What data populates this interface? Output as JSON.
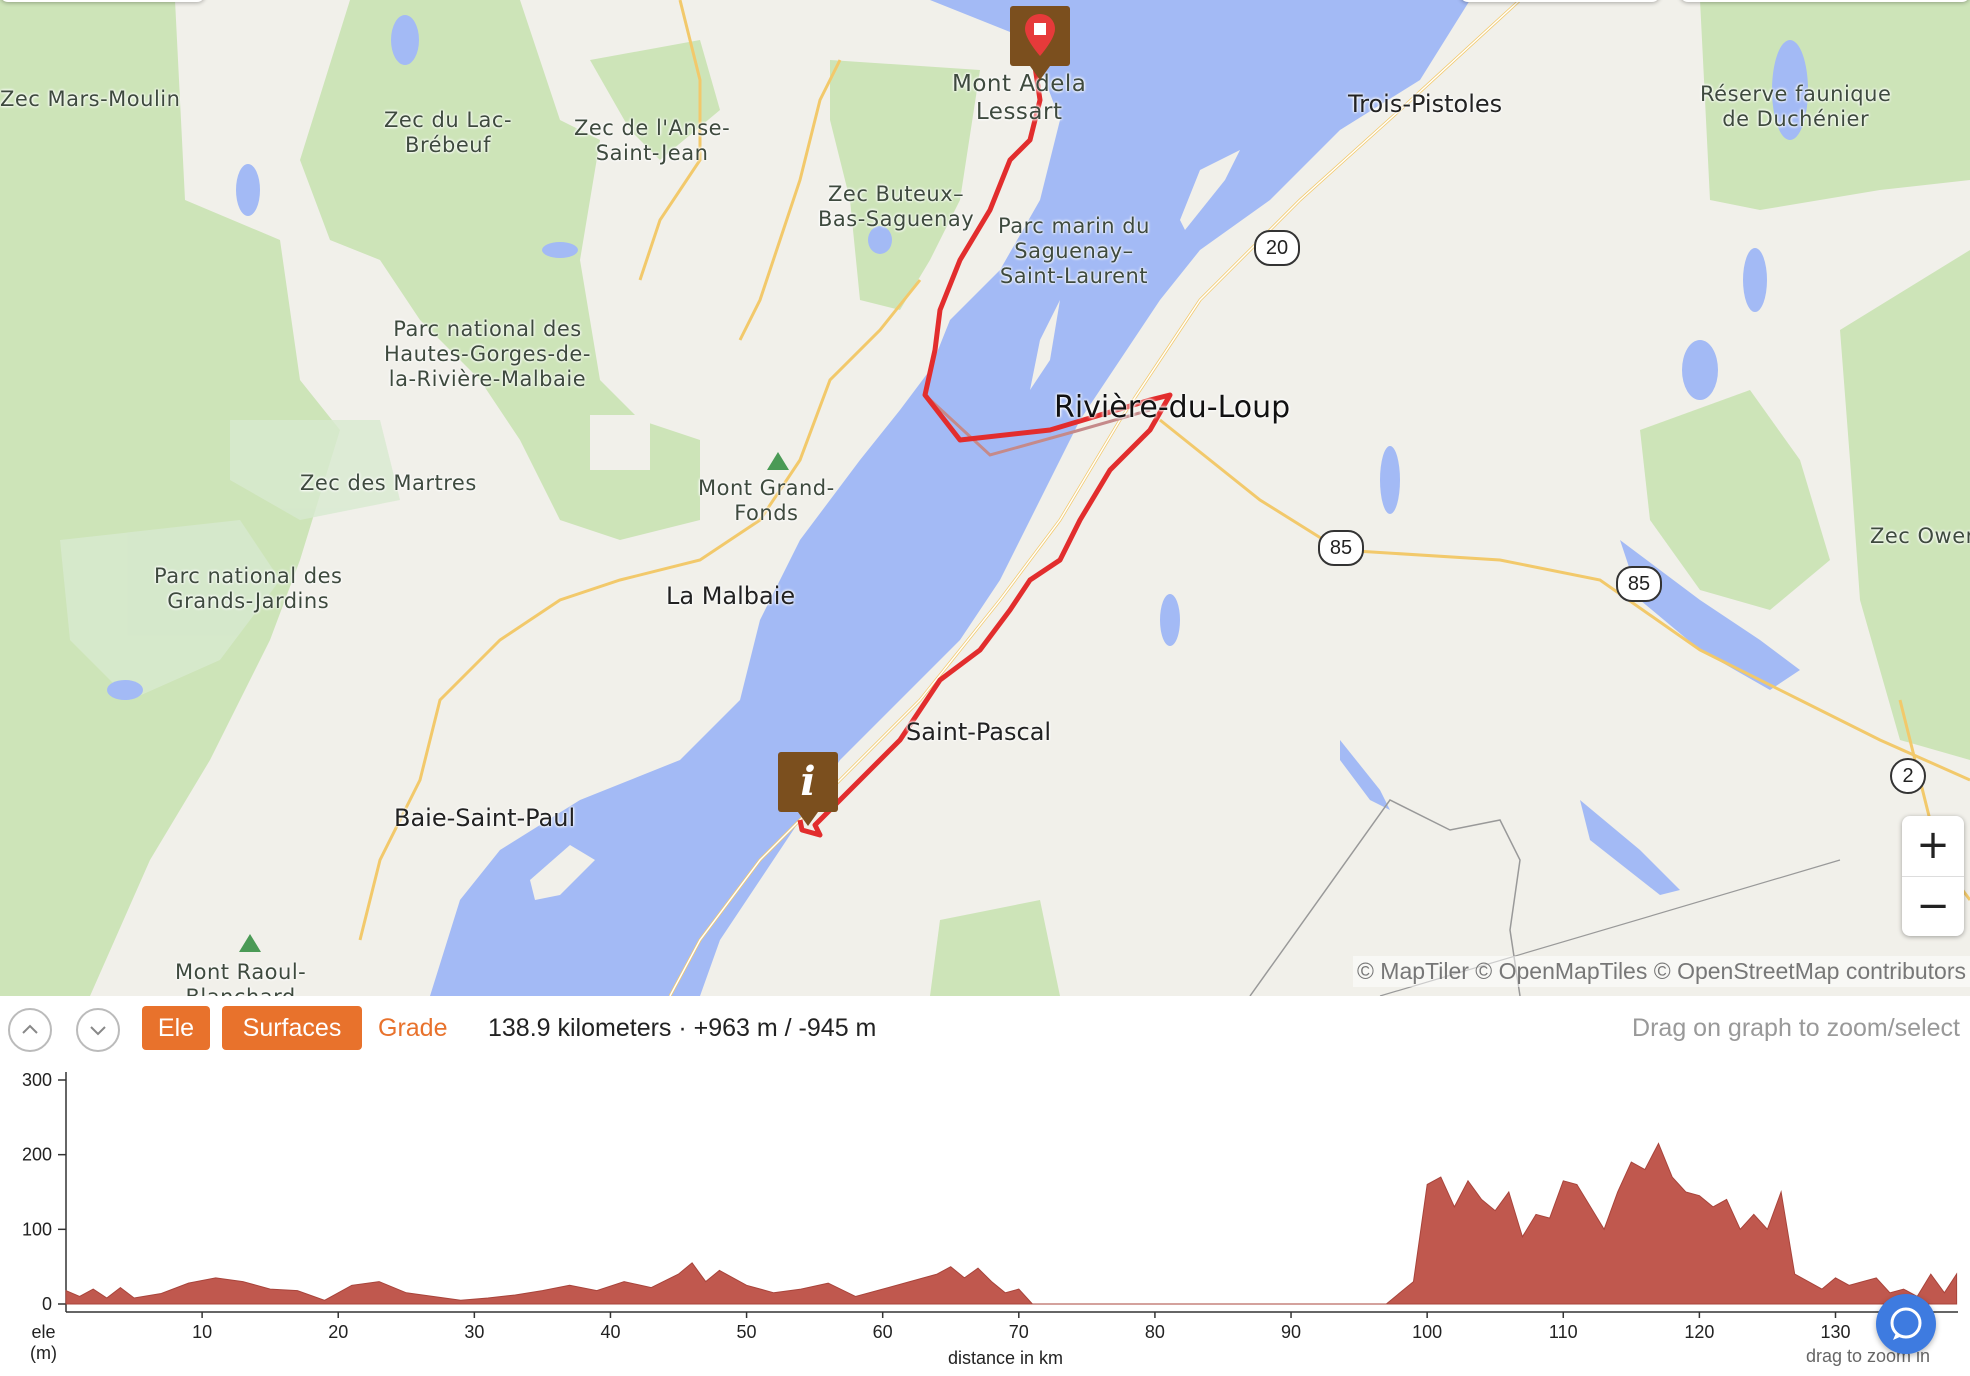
{
  "map": {
    "labels": {
      "zec_mars_moulin": "Zec Mars-Moulin",
      "zec_lac_brebeuf_1": "Zec du Lac-",
      "zec_lac_brebeuf_2": "Brébeuf",
      "zec_anse_1": "Zec de l'Anse-",
      "zec_anse_2": "Saint-Jean",
      "zec_buteux_1": "Zec Buteux–",
      "zec_buteux_2": "Bas-Saguenay",
      "parc_marin_1": "Parc marin du",
      "parc_marin_2": "Saguenay–",
      "parc_marin_3": "Saint-Laurent",
      "hautes_gorges_1": "Parc national des",
      "hautes_gorges_2": "Hautes-Gorges-de-",
      "hautes_gorges_3": "la-Rivière-Malbaie",
      "zec_martres": "Zec des Martres",
      "grands_jardins_1": "Parc national des",
      "grands_jardins_2": "Grands-Jardins",
      "mont_grand_fonds_1": "Mont Grand-",
      "mont_grand_fonds_2": "Fonds",
      "mont_adela_1": "Mont Adela",
      "mont_adela_2": "Lessart",
      "mont_raoul_1": "Mont Raoul-",
      "mont_raoul_2": "Blanchard",
      "reserve_1": "Réserve faunique",
      "reserve_2": "de Duchénier",
      "zec_owen": "Zec Owen"
    },
    "towns": {
      "trois_pistoles": "Trois-Pistoles",
      "riviere_du_loup": "Rivière-du-Loup",
      "la_malbaie": "La Malbaie",
      "saint_pascal": "Saint-Pascal",
      "baie_saint_paul": "Baie-Saint-Paul"
    },
    "shields": {
      "r20": "20",
      "r85a": "85",
      "r85b": "85",
      "r2": "2"
    },
    "attribution": "© MapTiler © OpenMapTiles © OpenStreetMap contributors",
    "zoom_in": "+",
    "zoom_out": "−",
    "info_marker": "i"
  },
  "panel": {
    "ele_button": "Ele",
    "surfaces_button": "Surfaces",
    "grade_button": "Grade",
    "stats": "138.9 kilometers · +963 m / -945 m",
    "hint": "Drag on graph to zoom/select",
    "y_axis_label_1": "ele",
    "y_axis_label_2": "(m)",
    "x_axis_label": "distance in km",
    "drag_zoom": "drag to zoom in"
  },
  "chart_data": {
    "type": "area",
    "xlabel": "distance in km",
    "ylabel": "ele (m)",
    "xlim": [
      0,
      139
    ],
    "ylim": [
      0,
      300
    ],
    "x_ticks": [
      10,
      20,
      30,
      40,
      50,
      60,
      70,
      80,
      90,
      100,
      110,
      120,
      130
    ],
    "y_ticks": [
      0,
      100,
      200,
      300
    ],
    "color": "#c0584e",
    "x": [
      0,
      1,
      2,
      3,
      4,
      5,
      7,
      9,
      11,
      13,
      15,
      17,
      19,
      21,
      23,
      25,
      27,
      29,
      31,
      33,
      35,
      37,
      39,
      41,
      43,
      45,
      46,
      47,
      48,
      50,
      52,
      54,
      56,
      58,
      60,
      62,
      64,
      65,
      66,
      67,
      68,
      69,
      70,
      71,
      72,
      80,
      90,
      97,
      98,
      99,
      100,
      101,
      102,
      103,
      104,
      105,
      106,
      107,
      108,
      109,
      110,
      111,
      112,
      113,
      114,
      115,
      116,
      117,
      118,
      119,
      120,
      121,
      122,
      123,
      124,
      125,
      126,
      127,
      128,
      129,
      130,
      131,
      132,
      133,
      134,
      135,
      136,
      137,
      138,
      138.9
    ],
    "values": [
      18,
      10,
      20,
      8,
      22,
      8,
      14,
      28,
      35,
      30,
      20,
      18,
      5,
      25,
      30,
      15,
      10,
      5,
      8,
      12,
      18,
      25,
      18,
      30,
      22,
      40,
      55,
      30,
      45,
      25,
      15,
      20,
      28,
      10,
      20,
      30,
      40,
      50,
      35,
      48,
      30,
      15,
      20,
      0,
      0,
      0,
      0,
      0,
      15,
      30,
      160,
      170,
      130,
      165,
      140,
      125,
      150,
      90,
      120,
      115,
      165,
      160,
      130,
      100,
      150,
      190,
      180,
      215,
      170,
      150,
      145,
      130,
      140,
      100,
      120,
      100,
      150,
      40,
      30,
      20,
      35,
      25,
      30,
      35,
      15,
      20,
      10,
      40,
      15,
      40
    ]
  }
}
